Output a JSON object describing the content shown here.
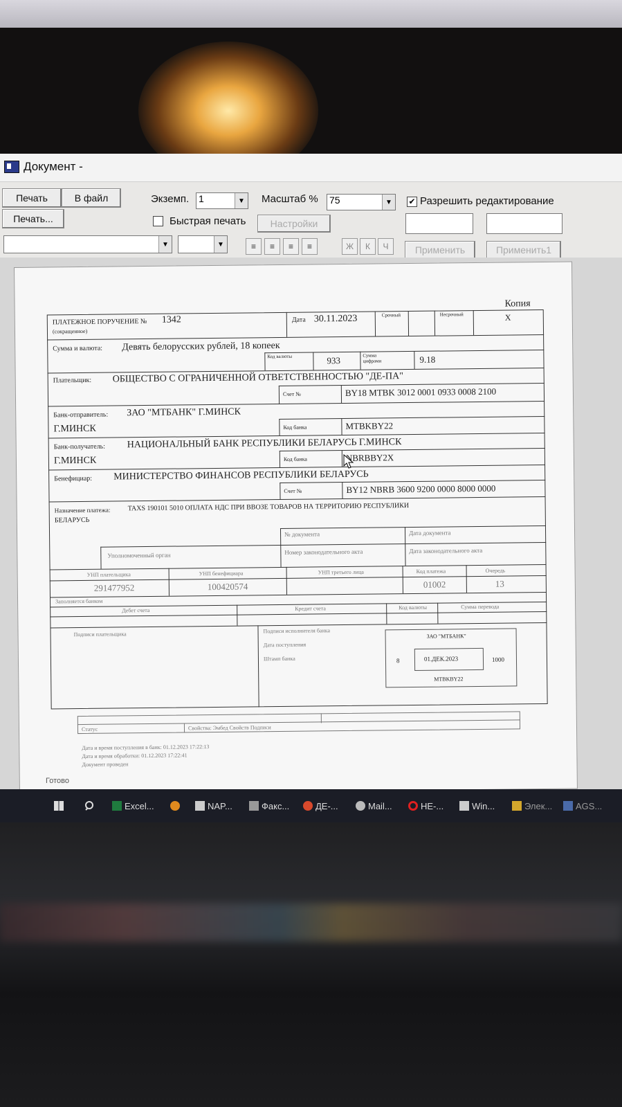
{
  "window": {
    "title": "Документ -"
  },
  "toolbar": {
    "print": "Печать",
    "to_file": "В файл",
    "print_dialog": "Печать...",
    "copies_label": "Экземп.",
    "copies_value": "1",
    "scale_label": "Масштаб %",
    "scale_value": "75",
    "allow_edit_label": "Разрешить редактирование",
    "allow_edit_checked": "✔",
    "quick_print_label": "Быстрая печать",
    "settings": "Настройки",
    "bold": "Ж",
    "italic": "К",
    "underline": "Ч",
    "apply": "Применить",
    "apply_all": "Применить1"
  },
  "doc": {
    "copy": "Копия",
    "copy_mark": "X",
    "title": "ПЛАТЕЖНОЕ ПОРУЧЕНИЕ №",
    "number": "1342",
    "abbrev": "(сокращенное)",
    "date_label": "Дата",
    "date": "30.11.2023",
    "urgent_label": "Срочный",
    "regular_label": "Несрочный",
    "amount_words_label": "Сумма и валюта:",
    "amount_words": "Девять белорусских рублей, 18 копеек",
    "currency_code_label": "Код валюты",
    "currency_code": "933",
    "amount_digits_label": "Сумма цифрами",
    "amount_digits": "9.18",
    "payer_label": "Плательщик:",
    "payer": "ОБЩЕСТВО С ОГРАНИЧЕННОЙ ОТВЕТСТВЕННОСТЬЮ \"ДЕ-ПА\"",
    "account_label": "Счет №",
    "payer_account": "BY18 MTBK 3012 0001 0933 0008 2100",
    "sender_bank_label": "Банк-отправитель:",
    "sender_bank": "ЗАО \"МТБАНК\" Г.МИНСК",
    "sender_bank_city": "Г.МИНСК",
    "bank_code_label": "Код банка",
    "sender_bank_code": "MTBKBY22",
    "recipient_bank_label": "Банк-получатель:",
    "recipient_bank": "НАЦИОНАЛЬНЫЙ БАНК РЕСПУБЛИКИ БЕЛАРУСЬ Г.МИНСК",
    "recipient_bank_city": "Г.МИНСК",
    "recipient_bank_code": "NBRBBY2X",
    "beneficiary_label": "Бенефициар:",
    "beneficiary": "МИНИСТЕРСТВО ФИНАНСОВ РЕСПУБЛИКИ БЕЛАРУСЬ",
    "beneficiary_account": "BY12 NBRB 3600 9200 0000 8000 0000",
    "purpose_label": "Назначение платежа:",
    "purpose": "TAXS 190101 5010 ОПЛАТА НДС ПРИ ВВОЗЕ ТОВАРОВ НА ТЕРРИТОРИЮ РЕСПУБЛИКИ",
    "purpose_cont": "БЕЛАРУСЬ",
    "doc_no_label": "№ документа",
    "doc_date_label": "Дата документа",
    "authority_label": "Уполномоченный орган",
    "law_no_label": "Номер законодательного акта",
    "law_date_label": "Дата законодательного акта",
    "unp_payer_label": "УНП плательщика",
    "unp_benef_label": "УНП бенефициара",
    "unp_third_label": "УНП третьего лица",
    "pay_code_label": "Код платежа",
    "queue_label": "Очередь",
    "unp_payer": "291477952",
    "unp_benef": "100420574",
    "pay_code": "01002",
    "queue": "13",
    "bank_fill_label": "Заполняется банком",
    "debit_label": "Дебет счета",
    "credit_label": "Кредит счета",
    "currency_label2": "Код валюты",
    "transfer_amount_label": "Сумма перевода",
    "payer_signature_label": "Подписи плательщика",
    "bank_signature_label": "Подписи исполнителя банка",
    "receipt_date_label": "Дата поступления",
    "bank_stamp_label": "Штамп банка",
    "stamp_bank": "ЗАО \"МТБАНК\"",
    "stamp_left": "8",
    "stamp_date": "01.ДЕК.2023",
    "stamp_right": "1000",
    "stamp_code": "MTBKBY22",
    "footer_status": "Статус",
    "footer_signature": "Свойства: Эмбед Свойств Подписи",
    "footer_line1": "Дата и время поступления в банк: 01.12.2023 17:22:13",
    "footer_line2": "Дата и время обработки: 01.12.2023 17:22:41",
    "footer_line3": "Документ проведен"
  },
  "status": {
    "ready": "Готово"
  },
  "taskbar": {
    "items": [
      "Excel...",
      "NAP...",
      "Факс...",
      "ДЕ-...",
      "Mail...",
      "НЕ-...",
      "Win...",
      "Элек...",
      "AGS..."
    ]
  }
}
